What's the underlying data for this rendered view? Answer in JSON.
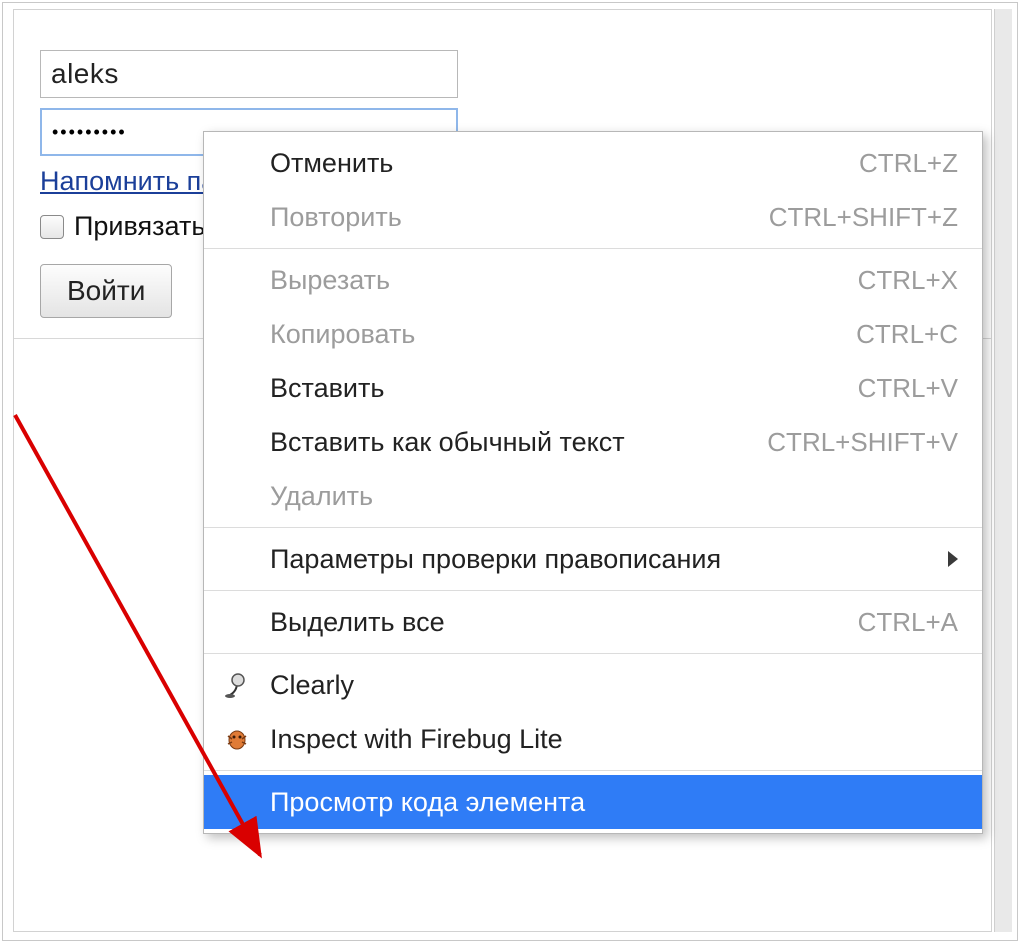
{
  "form": {
    "username_value": "aleks",
    "password_mask": "•••••••••",
    "remind_link": "Напомнить пароль",
    "bind_checkbox_label": "Привязать",
    "login_button": "Войти"
  },
  "context_menu": {
    "items": [
      {
        "label": "Отменить",
        "shortcut": "CTRL+Z",
        "enabled": true
      },
      {
        "label": "Повторить",
        "shortcut": "CTRL+SHIFT+Z",
        "enabled": false
      },
      {
        "sep": true
      },
      {
        "label": "Вырезать",
        "shortcut": "CTRL+X",
        "enabled": false
      },
      {
        "label": "Копировать",
        "shortcut": "CTRL+C",
        "enabled": false
      },
      {
        "label": "Вставить",
        "shortcut": "CTRL+V",
        "enabled": true
      },
      {
        "label": "Вставить как обычный текст",
        "shortcut": "CTRL+SHIFT+V",
        "enabled": true
      },
      {
        "label": "Удалить",
        "shortcut": "",
        "enabled": false
      },
      {
        "sep": true
      },
      {
        "label": "Параметры проверки правописания",
        "shortcut": "",
        "enabled": true,
        "submenu": true
      },
      {
        "sep": true
      },
      {
        "label": "Выделить все",
        "shortcut": "CTRL+A",
        "enabled": true
      },
      {
        "sep": true
      },
      {
        "label": "Clearly",
        "shortcut": "",
        "enabled": true,
        "icon": "lamp"
      },
      {
        "label": "Inspect with Firebug Lite",
        "shortcut": "",
        "enabled": true,
        "icon": "firebug"
      },
      {
        "sep": true
      },
      {
        "label": "Просмотр кода элемента",
        "shortcut": "",
        "enabled": true,
        "highlight": true
      }
    ]
  }
}
